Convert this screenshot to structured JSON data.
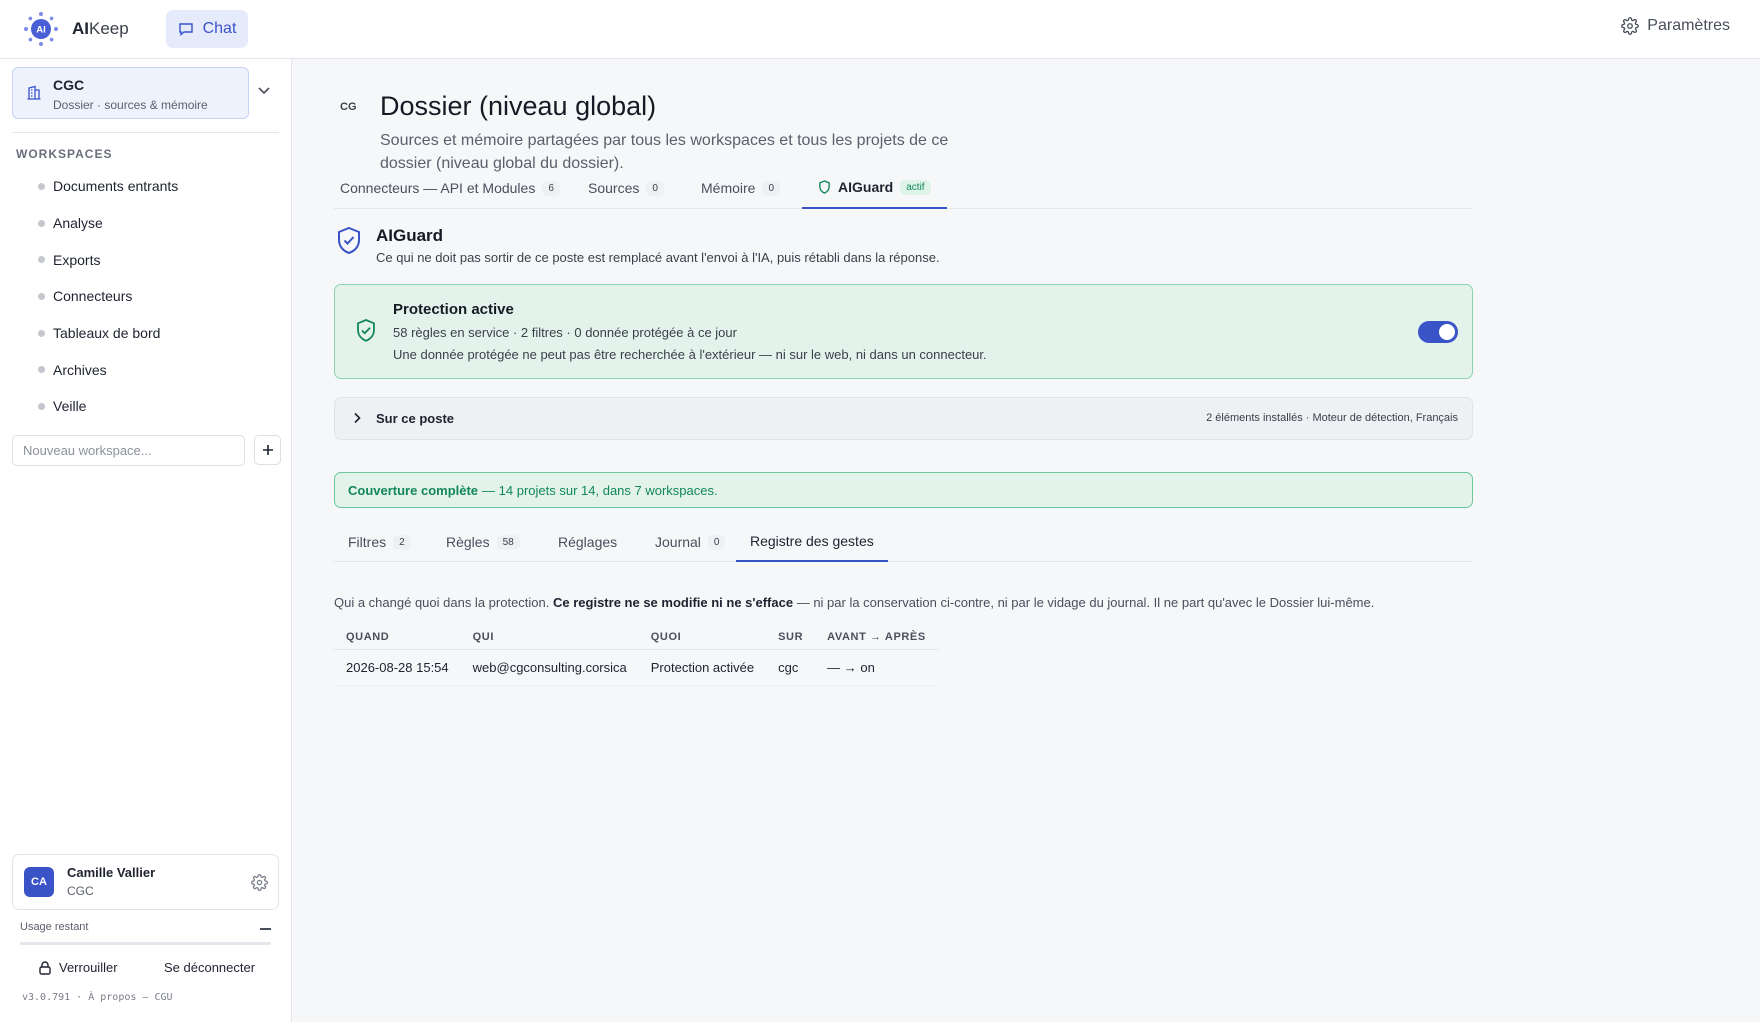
{
  "header": {
    "logo_text": "AI",
    "brand_bold": "AI",
    "brand_rest": "Keep",
    "chat_label": "Chat",
    "settings_label": "Paramètres"
  },
  "sidebar": {
    "folder": {
      "title": "CGC",
      "subtitle": "Dossier · sources & mémoire"
    },
    "workspaces_heading": "WORKSPACES",
    "workspaces": [
      {
        "label": "Documents entrants"
      },
      {
        "label": "Analyse"
      },
      {
        "label": "Exports"
      },
      {
        "label": "Connecteurs"
      },
      {
        "label": "Tableaux de bord"
      },
      {
        "label": "Archives"
      },
      {
        "label": "Veille"
      }
    ],
    "new_workspace_placeholder": "Nouveau workspace...",
    "user": {
      "initials": "CA",
      "name": "Camille Vallier",
      "org": "CGC"
    },
    "usage_label": "Usage restant",
    "lock_label": "Verrouiller",
    "logout_label": "Se déconnecter",
    "version": "v3.0.791 · À propos — CGU"
  },
  "main": {
    "badge": "CG",
    "title": "Dossier (niveau global)",
    "description": "Sources et mémoire partagées par tous les workspaces et tous les projets de ce dossier (niveau global du dossier).",
    "tabs": [
      {
        "label": "Connecteurs — API et Modules",
        "count": "6"
      },
      {
        "label": "Sources",
        "count": "0"
      },
      {
        "label": "Mémoire",
        "count": "0"
      },
      {
        "label": "AIGuard",
        "tag": "actif"
      }
    ],
    "guard": {
      "title": "AIGuard",
      "description": "Ce qui ne doit pas sortir de ce poste est remplacé avant l'envoi à l'IA, puis rétabli dans la réponse."
    },
    "protection": {
      "title": "Protection active",
      "line1": "58 règles en service · 2 filtres · 0 donnée protégée à ce jour",
      "line2": "Une donnée protégée ne peut pas être recherchée à l'extérieur — ni sur le web, ni dans un connecteur.",
      "enabled": true
    },
    "poste": {
      "label": "Sur ce poste",
      "meta": "2 éléments installés · Moteur de détection, Français"
    },
    "coverage": {
      "bold": "Couverture complète",
      "rest": "— 14 projets sur 14, dans 7 workspaces."
    },
    "subtabs": [
      {
        "label": "Filtres",
        "count": "2"
      },
      {
        "label": "Règles",
        "count": "58"
      },
      {
        "label": "Réglages"
      },
      {
        "label": "Journal",
        "count": "0"
      },
      {
        "label": "Registre des gestes"
      }
    ],
    "registre": {
      "desc_start": "Qui a changé quoi dans la protection.",
      "desc_bold": "Ce registre ne se modifie ni ne s'efface",
      "desc_end": "— ni par la conservation ci-contre, ni par le vidage du journal. Il ne part qu'avec le Dossier lui-même.",
      "columns": [
        "QUAND",
        "QUI",
        "QUOI",
        "SUR",
        "AVANT → APRÈS"
      ],
      "rows": [
        {
          "quand": "2026-08-28 15:54",
          "qui": "web@cgconsulting.corsica",
          "quoi": "Protection activée",
          "sur": "cgc",
          "avant_apres": "— → on"
        }
      ]
    }
  },
  "colors": {
    "accent": "#3a53c7",
    "success": "#12875a",
    "success_bg": "#e3f3ec"
  }
}
